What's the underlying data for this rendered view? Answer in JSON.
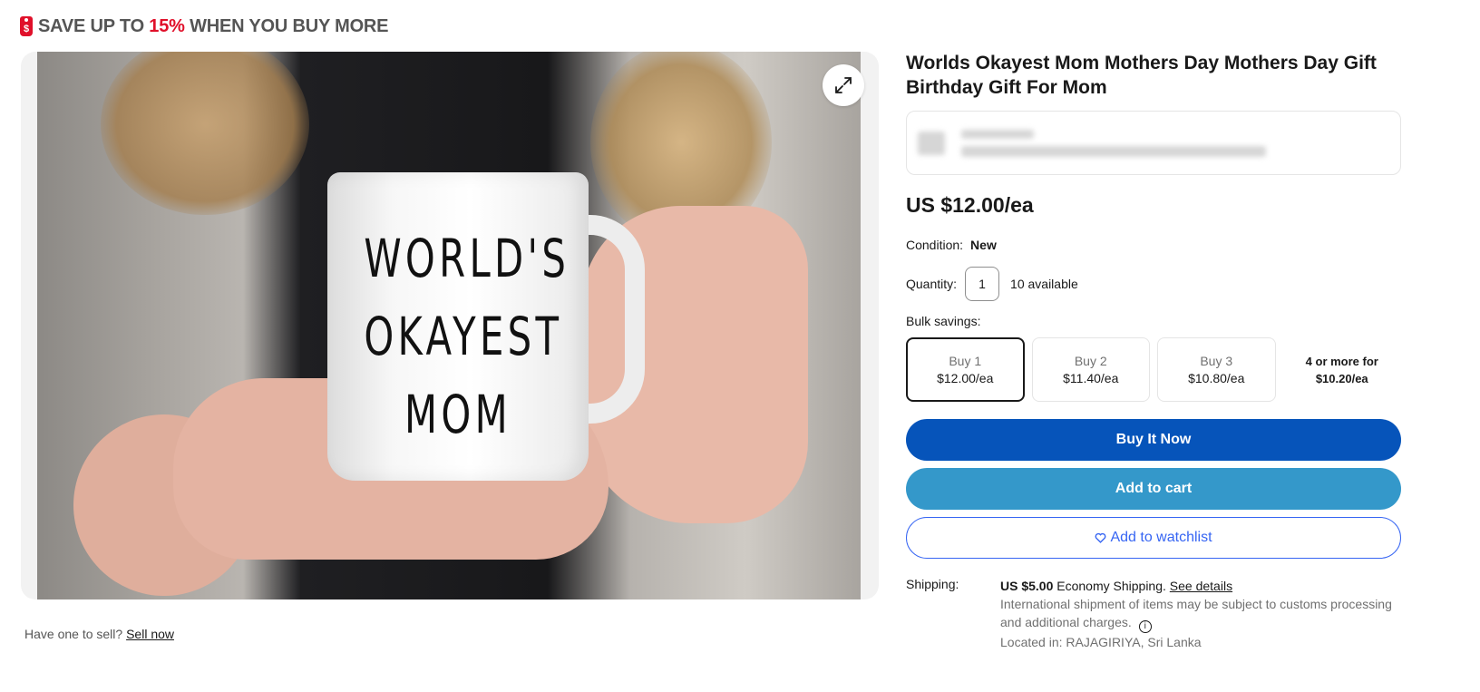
{
  "promo": {
    "prefix": "SAVE UP TO",
    "percent": "15%",
    "suffix": "WHEN YOU BUY MORE",
    "icon": "sale-tag-icon"
  },
  "gallery": {
    "mug_lines": [
      "WORLD'S",
      "OKAYEST",
      "MOM"
    ],
    "expand_icon": "expand-arrows-icon"
  },
  "sell": {
    "prompt": "Have one to sell?",
    "link": "Sell now"
  },
  "product": {
    "title": "Worlds Okayest Mom Mothers Day Mothers Day Gift Birthday Gift For Mom",
    "price": "US $12.00/ea",
    "condition_label": "Condition:",
    "condition_value": "New",
    "quantity_label": "Quantity:",
    "quantity_value": "1",
    "available": "10 available",
    "bulk_label": "Bulk savings:",
    "bulk_options": [
      {
        "qty": "Buy 1",
        "price": "$12.00/ea",
        "selected": true
      },
      {
        "qty": "Buy 2",
        "price": "$11.40/ea",
        "selected": false
      },
      {
        "qty": "Buy 3",
        "price": "$10.80/ea",
        "selected": false
      },
      {
        "qty": "4 or more for",
        "price": "$10.20/ea",
        "selected": false
      }
    ]
  },
  "actions": {
    "buy_now": "Buy It Now",
    "add_to_cart": "Add to cart",
    "watchlist": "Add to watchlist",
    "watch_icon": "heart-icon"
  },
  "shipping": {
    "label": "Shipping:",
    "cost": "US $5.00",
    "method": "Economy Shipping.",
    "details_link": "See details",
    "note": "International shipment of items may be subject to customs processing and additional charges.",
    "location": "Located in: RAJAGIRIYA, Sri Lanka"
  },
  "colors": {
    "sale_red": "#e0102a",
    "buy_blue": "#0654ba",
    "cart_blue": "#3498ca",
    "link_blue": "#3665f3"
  }
}
